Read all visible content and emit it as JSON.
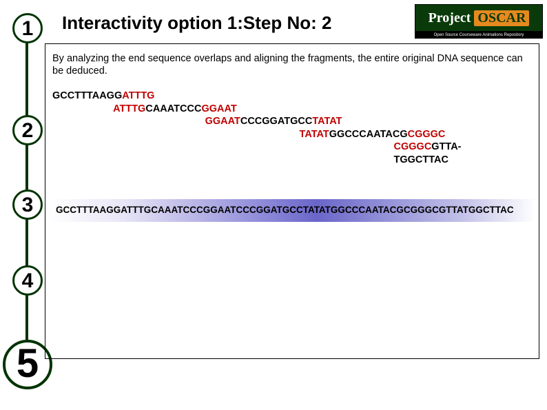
{
  "header": {
    "title": "Interactivity option 1:Step No: 2",
    "logo_project": "Project",
    "logo_oscar": "OSCAR",
    "logo_sub": "Open Source Courseware Animations Repository"
  },
  "steps": {
    "n1": "1",
    "n2": "2",
    "n3": "3",
    "n4": "4",
    "n5": "5"
  },
  "content": {
    "intro": "By analyzing the end sequence overlaps and aligning the fragments, the entire original DNA sequence can be deduced.",
    "frag": {
      "line1a": "GCCTTTAAGG",
      "line1b": "ATTTG",
      "pad2": "                      ",
      "line2a": "ATTTG",
      "line2b": "CAAATCCC",
      "line2c": "GGAAT",
      "pad3": "                                                       ",
      "line3a": "GGAAT",
      "line3b": "CCCGGATGCC",
      "line3c": "TATAT",
      "pad4": "                                                                                         ",
      "line4a": "TATAT",
      "line4b": "GGCCCAATACG",
      "line4c": "CGGGC",
      "pad5": "                                                                                                                           ",
      "line5a": "CGGGC",
      "line5b": "GTTA-",
      "pad6": "                                                                                                                           ",
      "line6": "TGGCTTAC"
    },
    "result": "GCCTTTAAGGATTTGCAAATCCCGGAATCCCGGATGCCTATATGGCCCAATACGCGGGCGTTATGGCTTAC"
  }
}
